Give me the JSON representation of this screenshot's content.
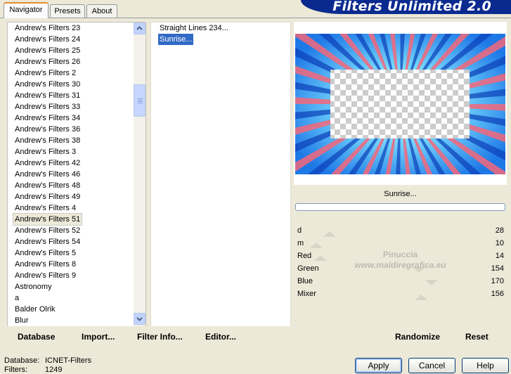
{
  "tabs": [
    {
      "label": "Navigator",
      "active": true
    },
    {
      "label": "Presets",
      "active": false
    },
    {
      "label": "About",
      "active": false
    }
  ],
  "banner_title": "Filters Unlimited 2.0",
  "categories": [
    "Andrew's Filters 23",
    "Andrew's Filters 24",
    "Andrew's Filters 25",
    "Andrew's Filters 26",
    "Andrew's Filters 2",
    "Andrew's Filters 30",
    "Andrew's Filters 31",
    "Andrew's Filters 33",
    "Andrew's Filters 34",
    "Andrew's Filters 36",
    "Andrew's Filters 38",
    "Andrew's Filters 3",
    "Andrew's Filters 42",
    "Andrew's Filters 46",
    "Andrew's Filters 48",
    "Andrew's Filters 49",
    "Andrew's Filters 4",
    "Andrew's Filters 51",
    "Andrew's Filters 52",
    "Andrew's Filters 54",
    "Andrew's Filters 5",
    "Andrew's Filters 8",
    "Andrew's Filters 9",
    "Astronomy",
    "a",
    "Balder Olrik",
    "Blur"
  ],
  "selected_category": "Andrew's Filters 51",
  "filters": [
    "Straight Lines 234...",
    "Sunrise..."
  ],
  "selected_filter": "Sunrise...",
  "filter_name_display": "Sunrise...",
  "toolbar": {
    "database": "Database",
    "import": "Import...",
    "filter_info": "Filter Info...",
    "editor": "Editor...",
    "randomize": "Randomize",
    "reset": "Reset"
  },
  "params": [
    {
      "label": "d",
      "value": "28"
    },
    {
      "label": "m",
      "value": "10"
    },
    {
      "label": "Red",
      "value": "14"
    },
    {
      "label": "Green",
      "value": "154"
    },
    {
      "label": "Blue",
      "value": "170"
    },
    {
      "label": "Mixer",
      "value": "156"
    }
  ],
  "watermark": {
    "line1": "Pinuccia",
    "line2": "www.maldiregrafica.eu"
  },
  "status": {
    "database_label": "Database:",
    "database_value": "ICNET-Filters",
    "filters_label": "Filters:",
    "filters_value": "1249"
  },
  "buttons": {
    "apply": "Apply",
    "cancel": "Cancel",
    "help": "Help"
  },
  "colors": {
    "banner": "#0a2a8f",
    "selection": "#316ac5",
    "tab_accent": "#e68b2c",
    "preview_blue": "#1e78e6",
    "preview_pink": "#f5677a"
  }
}
